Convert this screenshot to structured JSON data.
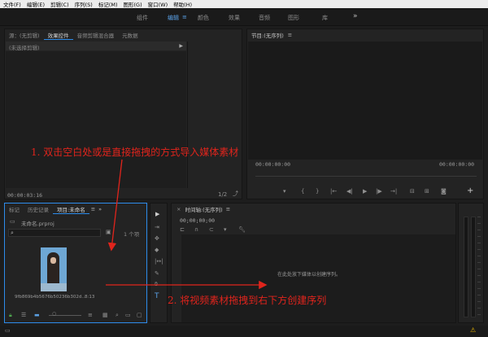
{
  "menu": [
    "文件(F)",
    "编辑(E)",
    "剪辑(C)",
    "序列(S)",
    "标记(M)",
    "图形(G)",
    "窗口(W)",
    "帮助(H)"
  ],
  "workspaces": [
    {
      "label": "组件",
      "active": false
    },
    {
      "label": "编辑",
      "active": true
    },
    {
      "label": "颜色",
      "active": false
    },
    {
      "label": "效果",
      "active": false
    },
    {
      "label": "音频",
      "active": false
    },
    {
      "label": "图形",
      "active": false
    },
    {
      "label": "库",
      "active": false
    }
  ],
  "workspace_menu_glyph": "≡",
  "workspace_more": "»",
  "source_panel": {
    "tabs": [
      "源：(无剪辑)",
      "效果控件",
      "音频剪辑混合器",
      "元数据"
    ],
    "no_clip": "(未选择剪辑)",
    "timecode": "00:00:03:16",
    "zoom": "1/2"
  },
  "program_panel": {
    "title": "节目:(无序列)",
    "tc_left": "00:00:00:00",
    "tc_right": "00:00:00:00"
  },
  "project_panel": {
    "tabs": [
      "标记",
      "历史记录",
      "项目:未命名"
    ],
    "project_file": "未命名.prproj",
    "item_count": "1 个项",
    "clip_name": "9fb869b4b5676b50236b302d...",
    "clip_duration": "8:13"
  },
  "timeline_panel": {
    "title": "时间轴:(无序列)",
    "timecode": "00;00;00;00",
    "drop_hint": "在此处放下媒体以创建序列。"
  },
  "annotations": {
    "step1": "1. 双击空白处或是直接拖拽的方式导入媒体素材",
    "step2": "2. 将视频素材拖拽到右下方创建序列"
  },
  "colors": {
    "accent": "#2d8ceb",
    "annotation": "#e0241c"
  }
}
